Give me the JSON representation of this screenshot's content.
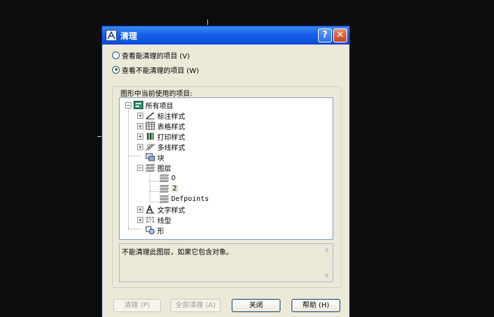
{
  "dialog": {
    "title": "清理",
    "help_glyph": "?",
    "close_glyph": "✕"
  },
  "radios": [
    {
      "label": "查看能清理的项目 (V)",
      "checked": false
    },
    {
      "label": "查看不能清理的项目 (W)",
      "checked": true
    }
  ],
  "tree": {
    "group_label": "图形中当前使用的项目:",
    "root": "所有项目",
    "items": {
      "dim_styles": "标注样式",
      "table_styles": "表格样式",
      "plot_styles": "打印样式",
      "mline_styles": "多线样式",
      "blocks": "块",
      "layers": "图层",
      "layer_0": "0",
      "layer_2": "2",
      "layer_defpoints": "Defpoints",
      "text_styles": "文字样式",
      "linetypes": "线型",
      "shapes": "形"
    },
    "expand_plus": "+",
    "expand_minus": "−"
  },
  "description": "不能清理此图层，如果它包含对象。",
  "scroll_up": "▲",
  "scroll_down": "▼",
  "buttons": {
    "purge": "清理 (P)",
    "purge_all": "全部清理 (A)",
    "close": "关闭",
    "help": "帮助 (H)"
  },
  "colors": {
    "titlebar": "#1660e8",
    "dialog_bg": "#ece9d8",
    "radio_dot": "#2a8c2a"
  }
}
